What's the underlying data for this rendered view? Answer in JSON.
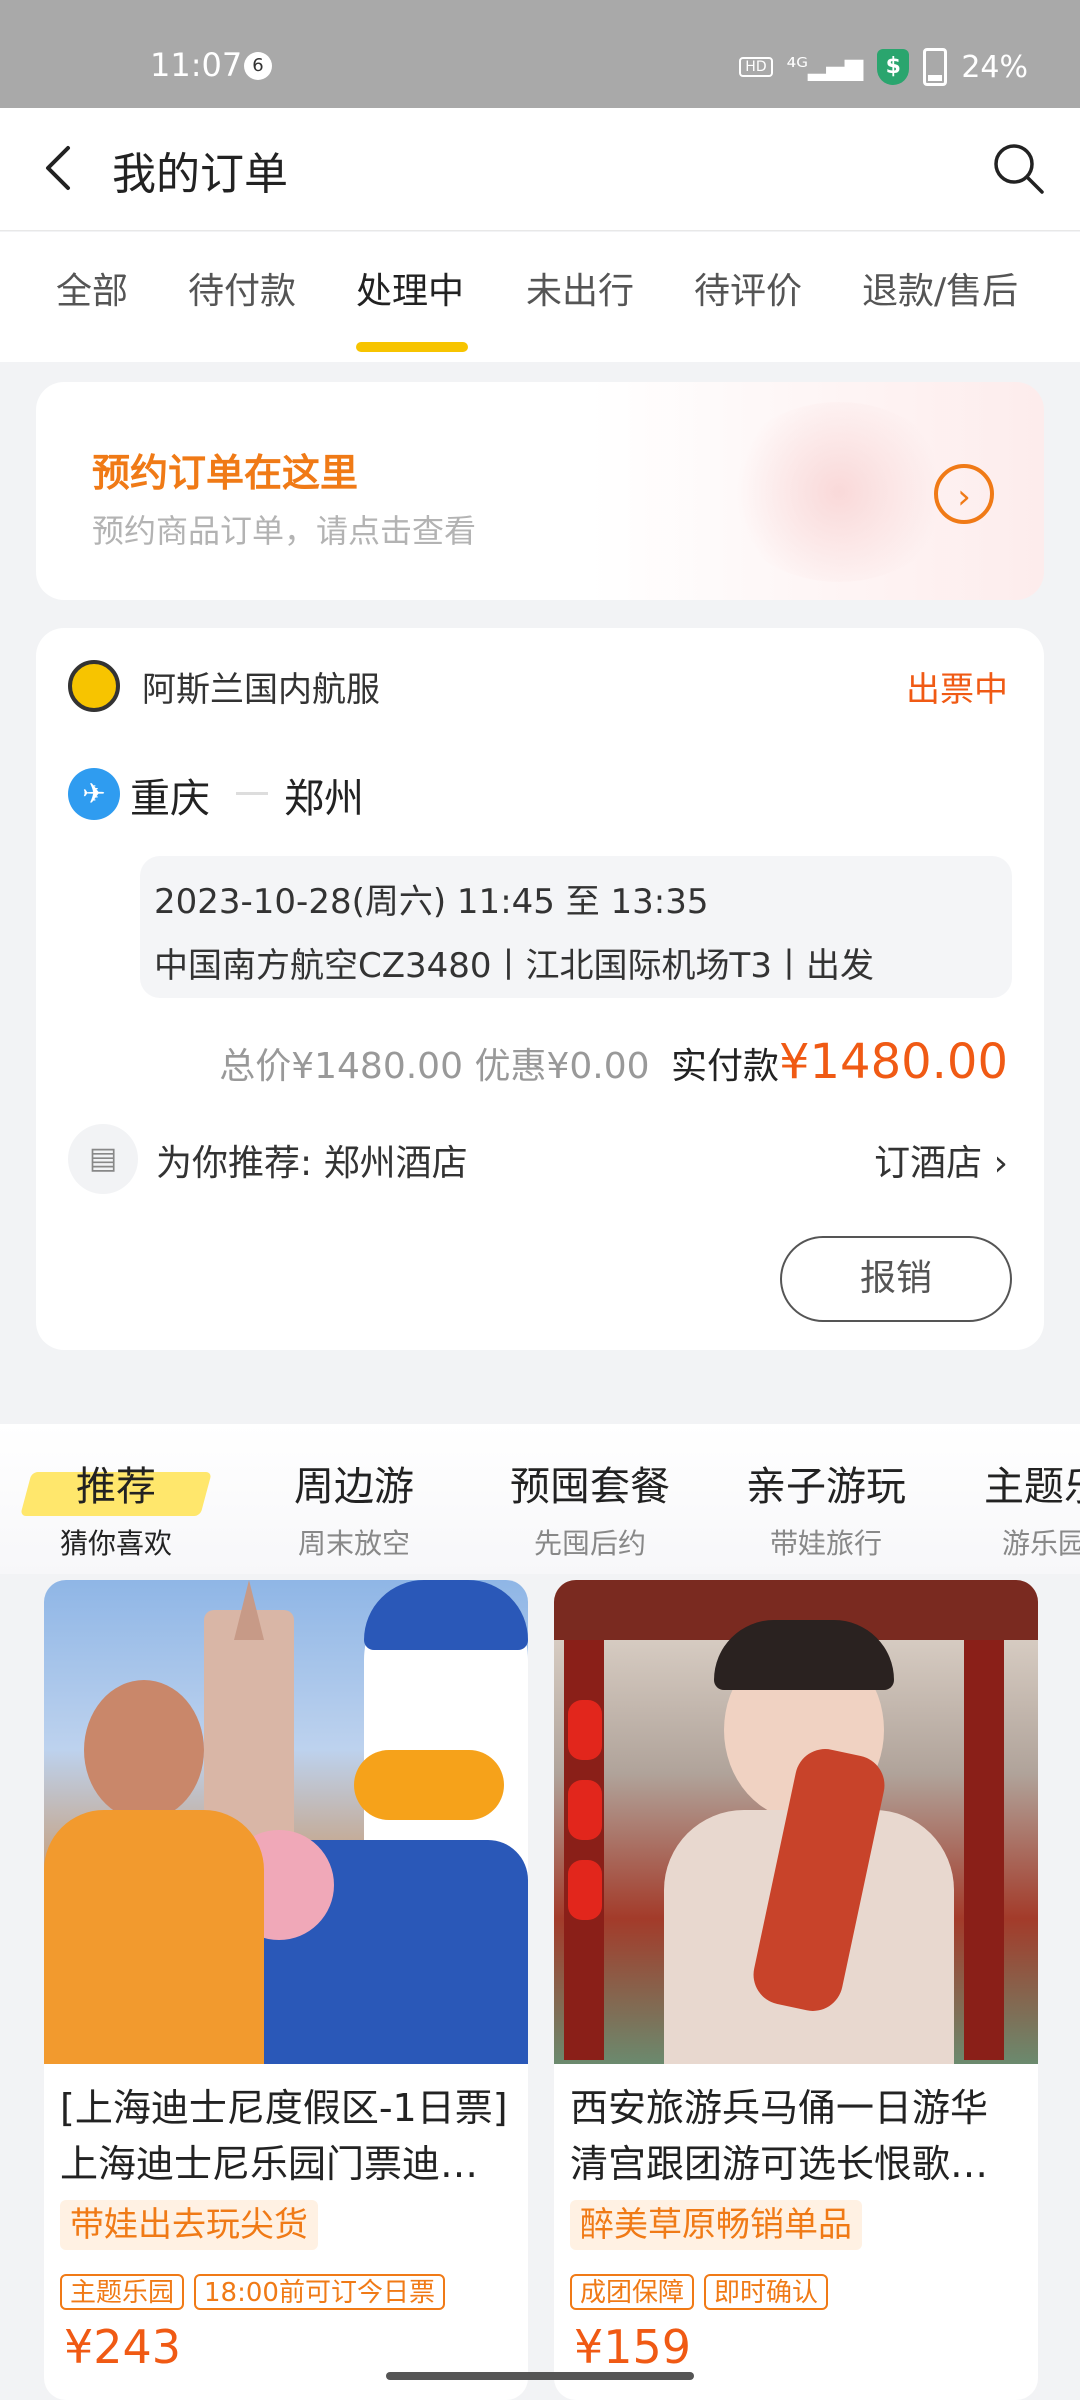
{
  "status_bar": {
    "time": "11:07",
    "notification_count": "6",
    "hd": "HD",
    "network": "⁴ᴳ",
    "battery": "24%"
  },
  "header": {
    "title": "我的订单"
  },
  "tabs": [
    "全部",
    "待付款",
    "处理中",
    "未出行",
    "待评价",
    "退款/售后"
  ],
  "active_tab": "处理中",
  "banner": {
    "title": "预约订单在这里",
    "subtitle": "预约商品订单，请点击查看"
  },
  "order": {
    "shop": "阿斯兰国内航服",
    "status": "出票中",
    "from": "重庆",
    "to": "郑州",
    "datetime": "2023-10-28(周六) 11:45 至 13:35",
    "flight": "中国南方航空CZ3480丨江北国际机场T3丨出发",
    "total": "总价¥1480.00",
    "discount": "优惠¥0.00",
    "paid_label": "实付款",
    "paid": "¥1480.00",
    "recommend": "为你推荐: 郑州酒店",
    "recommend_link": "订酒店",
    "action": "报销"
  },
  "rec_tabs": [
    {
      "main": "推荐",
      "sub": "猜你喜欢"
    },
    {
      "main": "周边游",
      "sub": "周末放空"
    },
    {
      "main": "预囤套餐",
      "sub": "先囤后约"
    },
    {
      "main": "亲子游玩",
      "sub": "带娃旅行"
    },
    {
      "main": "主题乐",
      "sub": "游乐园"
    }
  ],
  "products": [
    {
      "name_line1": "[上海迪士尼度假区-1日票]",
      "name_line2": "上海迪士尼乐园门票迪…",
      "promo": "带娃出去玩尖货",
      "tags": [
        "主题乐园",
        "18:00前可订今日票"
      ],
      "price": "¥243"
    },
    {
      "name_line1": "西安旅游兵马俑一日游华",
      "name_line2": "清宫跟团游可选长恨歌…",
      "promo": "醉美草原畅销单品",
      "tags": [
        "成团保障",
        "即时确认"
      ],
      "price": "¥159"
    }
  ],
  "colors": {
    "accent": "#f07a16",
    "price": "#f05a14",
    "tab_underline": "#f7c400",
    "flight_icon": "#2f9cf0"
  }
}
